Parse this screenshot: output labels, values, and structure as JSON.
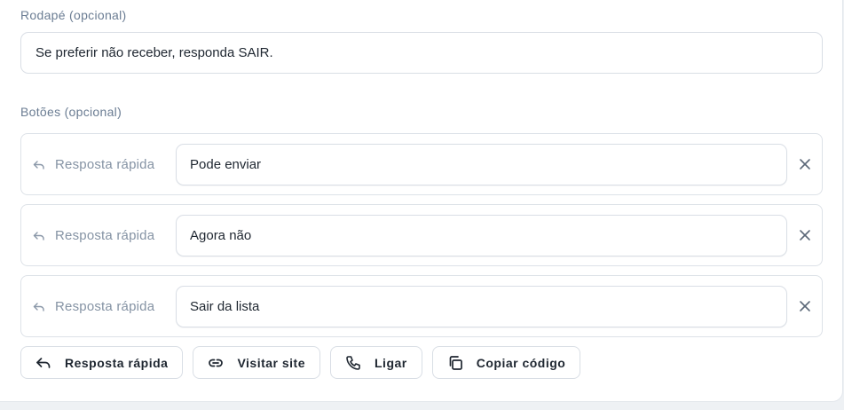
{
  "footer": {
    "label": "Rodapé (opcional)",
    "value": "Se preferir não receber, responda SAIR."
  },
  "buttons_section": {
    "label": "Botões (opcional)",
    "items": [
      {
        "type_label": "Resposta rápida",
        "type_icon": "reply-icon",
        "text": "Pode enviar"
      },
      {
        "type_label": "Resposta rápida",
        "type_icon": "reply-icon",
        "text": "Agora não"
      },
      {
        "type_label": "Resposta rápida",
        "type_icon": "reply-icon",
        "text": "Sair da lista"
      }
    ],
    "add_options": [
      {
        "label": "Resposta rápida",
        "icon": "reply-icon"
      },
      {
        "label": "Visitar site",
        "icon": "link-icon"
      },
      {
        "label": "Ligar",
        "icon": "phone-icon"
      },
      {
        "label": "Copiar código",
        "icon": "copy-icon"
      }
    ]
  },
  "colors": {
    "text": "#1e2630",
    "muted": "#6b7d93",
    "border": "#d9dee5"
  }
}
